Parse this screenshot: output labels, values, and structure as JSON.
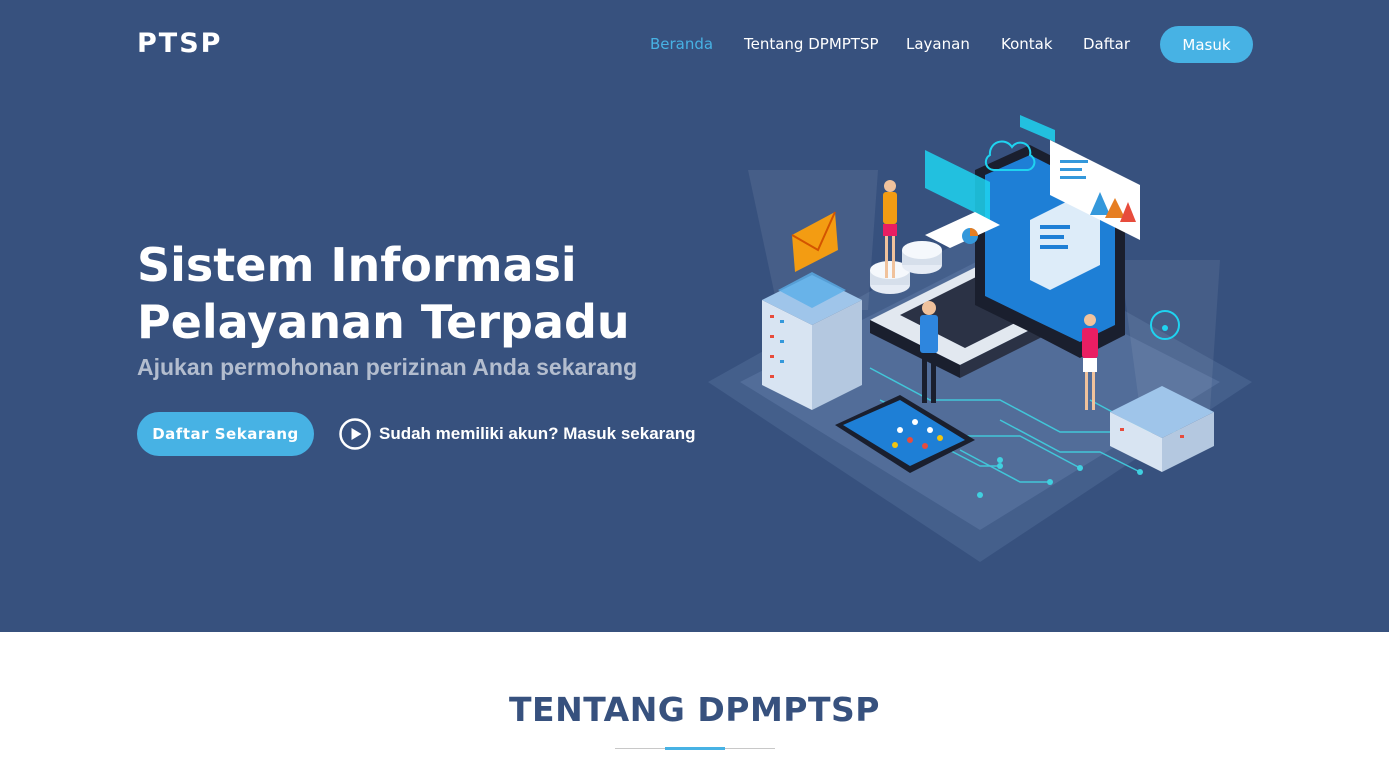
{
  "brand": {
    "logo": "PTSP"
  },
  "nav": {
    "items": [
      {
        "label": "Beranda",
        "active": true
      },
      {
        "label": "Tentang DPMPTSP",
        "active": false
      },
      {
        "label": "Layanan",
        "active": false
      },
      {
        "label": "Kontak",
        "active": false
      },
      {
        "label": "Daftar",
        "active": false
      }
    ],
    "login_label": "Masuk"
  },
  "hero": {
    "title_line1": "Sistem Informasi",
    "title_line2": "Pelayanan Terpadu",
    "subtitle": "Ajukan permohonan perizinan Anda sekarang",
    "register_label": "Daftar Sekarang",
    "login_prompt": "Sudah memiliki akun? Masuk sekarang"
  },
  "about": {
    "title": "TENTANG DPMPTSP"
  },
  "colors": {
    "hero_bg": "#37517e",
    "accent": "#47b2e4",
    "white": "#ffffff"
  },
  "icons": {
    "play": "play-circle-icon",
    "illustration": "isometric-data-center-illustration"
  }
}
